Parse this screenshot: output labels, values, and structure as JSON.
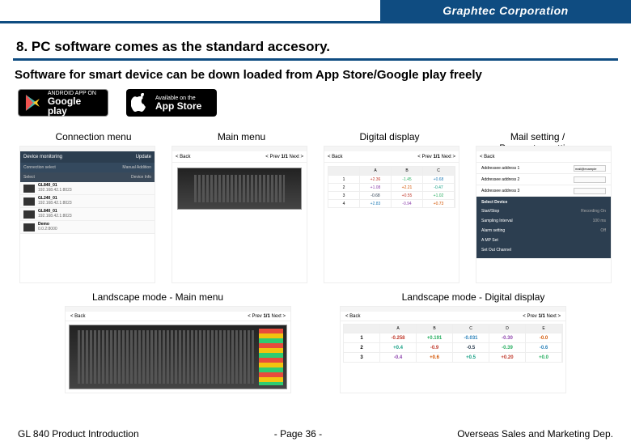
{
  "brand": "Graphtec Corporation",
  "section_title": "8. PC software comes as the standard accesory.",
  "subtitle": "Software for smart device can be down loaded from App Store/Google play freely",
  "badges": {
    "google": {
      "small": "ANDROID APP ON",
      "big": "Google play"
    },
    "apple": {
      "small": "Available on the",
      "big": "App Store"
    }
  },
  "captions": {
    "c1": "Connection menu",
    "c2": "Main menu",
    "c3": "Digital display",
    "c4_l1": "Mail setting /",
    "c4_l2": "Parameter setting"
  },
  "conn": {
    "header_l": "Device monitoring",
    "header_r": "Update",
    "sel_l": "Connection select",
    "sel_r": "Manual Addition",
    "col_l": "Select",
    "col_r": "Device Info",
    "rows": [
      {
        "n": "GL840_01",
        "s": "192.168.42.1:8023"
      },
      {
        "n": "GL240_01",
        "s": "192.168.42.1:8023"
      },
      {
        "n": "GL840_01",
        "s": "192.168.42.1:8023"
      },
      {
        "n": "Demo",
        "s": "0.0.2:8000"
      }
    ]
  },
  "main": {
    "back": "< Back",
    "prev": "< Prev",
    "pg": "1/1",
    "next": "Next >"
  },
  "digital": {
    "back": "< Back",
    "prev": "< Prev",
    "pg": "1/1",
    "next": "Next >",
    "head": [
      "",
      "A",
      "B",
      "C"
    ],
    "rows": [
      [
        "1",
        "+2.36",
        "-1.45",
        "+0.68"
      ],
      [
        "2",
        "+1.08",
        "+2.21",
        "-0.47"
      ],
      [
        "3",
        "-0.68",
        "+0.55",
        "+1.02"
      ],
      [
        "4",
        "+2.83",
        "-0.94",
        "+0.73"
      ]
    ],
    "colors": [
      [
        "#c0392b",
        "#27ae60",
        "#2980b9"
      ],
      [
        "#8e44ad",
        "#d35400",
        "#16a085"
      ],
      [
        "#2c3e50",
        "#c0392b",
        "#27ae60"
      ],
      [
        "#2980b9",
        "#8e44ad",
        "#d35400"
      ]
    ]
  },
  "mail": {
    "back": "< Back",
    "addr1": "Addressee address 1",
    "addr1v": "mail@example",
    "addr2": "Addressee address 2",
    "addr3": "Addressee address 3",
    "section": "Select Device",
    "rows": [
      [
        "Start/Stop",
        "Recording On"
      ],
      [
        "Sampling Interval",
        "100 ms"
      ],
      [
        "Alarm setting",
        "Off"
      ],
      [
        "A MP Set",
        ""
      ],
      [
        "Set Out Channel",
        ""
      ]
    ]
  },
  "land_captions": {
    "l1": "Landscape mode - Main menu",
    "l2": "Landscape mode - Digital display"
  },
  "land_main": {
    "back": "< Back",
    "prev": "< Prev",
    "pg": "1/1",
    "next": "Next >"
  },
  "land_digital": {
    "back": "< Back",
    "prev": "< Prev",
    "pg": "1/1",
    "next": "Next >",
    "head": [
      "",
      "A",
      "B",
      "C",
      "D",
      "E"
    ],
    "rows": [
      [
        "1",
        "-0.258",
        "+0.191",
        "-0.031",
        "-0.30",
        "-0.0"
      ],
      [
        "2",
        "+0.4",
        "-0.9",
        "-0.5",
        "-0.39",
        "-0.6"
      ],
      [
        "3",
        "-0.4",
        "+0.6",
        "+0.5",
        "+0.20",
        "+0.0"
      ]
    ],
    "colors": [
      [
        "#c0392b",
        "#27ae60",
        "#2980b9",
        "#8e44ad",
        "#d35400"
      ],
      [
        "#16a085",
        "#c0392b",
        "#2c3e50",
        "#27ae60",
        "#2980b9"
      ],
      [
        "#8e44ad",
        "#d35400",
        "#16a085",
        "#c0392b",
        "#27ae60"
      ]
    ]
  },
  "footer": {
    "left": "GL 840 Product Introduction",
    "center": "- Page 36 -",
    "right": "Overseas Sales and Marketing Dep."
  }
}
